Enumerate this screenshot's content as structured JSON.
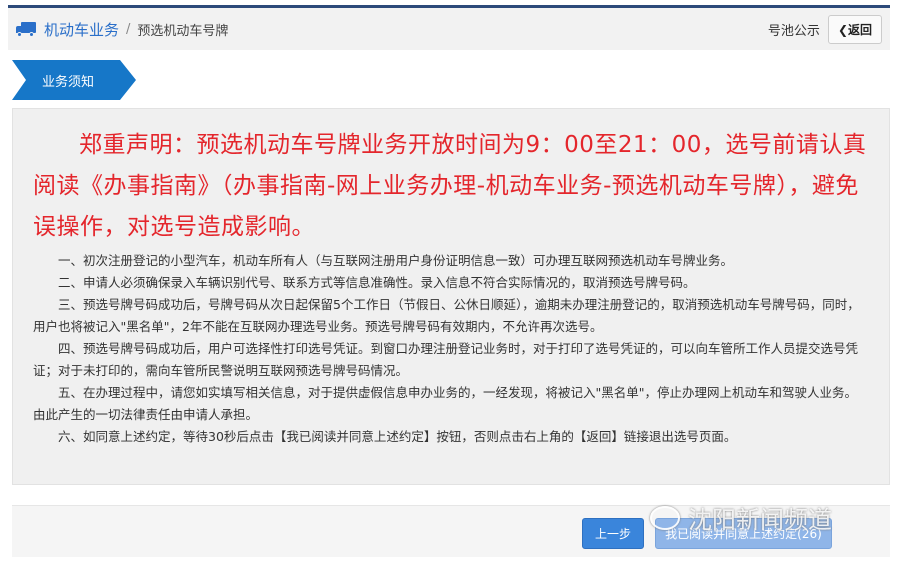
{
  "header": {
    "breadcrumb_root": "机动车业务",
    "breadcrumb_sep": "/",
    "breadcrumb_current": "预选机动车号牌",
    "pool_link": "号池公示",
    "back_button": "❮返回"
  },
  "tab": {
    "label": "业务须知"
  },
  "notice": {
    "statement": "郑重声明：预选机动车号牌业务开放时间为9：00至21：00，选号前请认真阅读《办事指南》（办事指南-网上业务办理-机动车业务-预选机动车号牌），避免误操作，对选号造成影响。"
  },
  "items": [
    "一、初次注册登记的小型汽车，机动车所有人（与互联网注册用户身份证明信息一致）可办理互联网预选机动车号牌业务。",
    "二、申请人必须确保录入车辆识别代号、联系方式等信息准确性。录入信息不符合实际情况的，取消预选号牌号码。",
    "三、预选号牌号码成功后，号牌号码从次日起保留5个工作日（节假日、公休日顺延），逾期未办理注册登记的，取消预选机动车号牌号码，同时，用户也将被记入\"黑名单\"，2年不能在互联网办理选号业务。预选号牌号码有效期内，不允许再次选号。",
    "四、预选号牌号码成功后，用户可选择性打印选号凭证。到窗口办理注册登记业务时，对于打印了选号凭证的，可以向车管所工作人员提交选号凭证；对于未打印的，需向车管所民警说明互联网预选号牌号码情况。",
    "五、在办理过程中，请您如实填写相关信息，对于提供虚假信息申办业务的，一经发现，将被记入\"黑名单\"，停止办理网上机动车和驾驶人业务。由此产生的一切法律责任由申请人承担。",
    "六、如同意上述约定，等待30秒后点击【我已阅读并同意上述约定】按钮，否则点击右上角的【返回】链接退出选号页面。"
  ],
  "footer": {
    "prev_button": "上一步",
    "agree_button": "我已阅读并同意上述约定(26)"
  },
  "watermark": "沈阳新闻频道"
}
